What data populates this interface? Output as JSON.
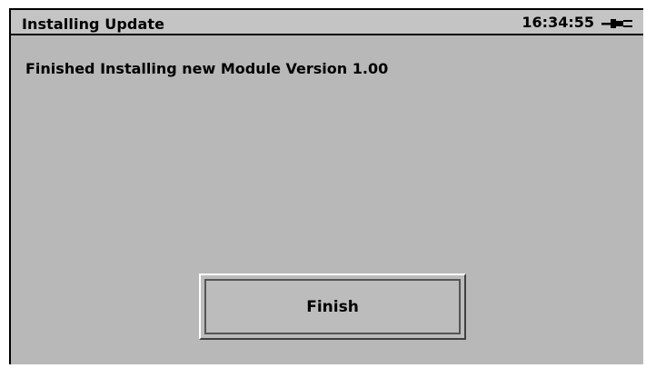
{
  "window": {
    "title": "Installing Update",
    "time": "16:34:55",
    "power_icon": "ac-power-plug-icon"
  },
  "main": {
    "message": "Finished Installing new Module Version 1.00"
  },
  "actions": {
    "finish_label": "Finish"
  }
}
